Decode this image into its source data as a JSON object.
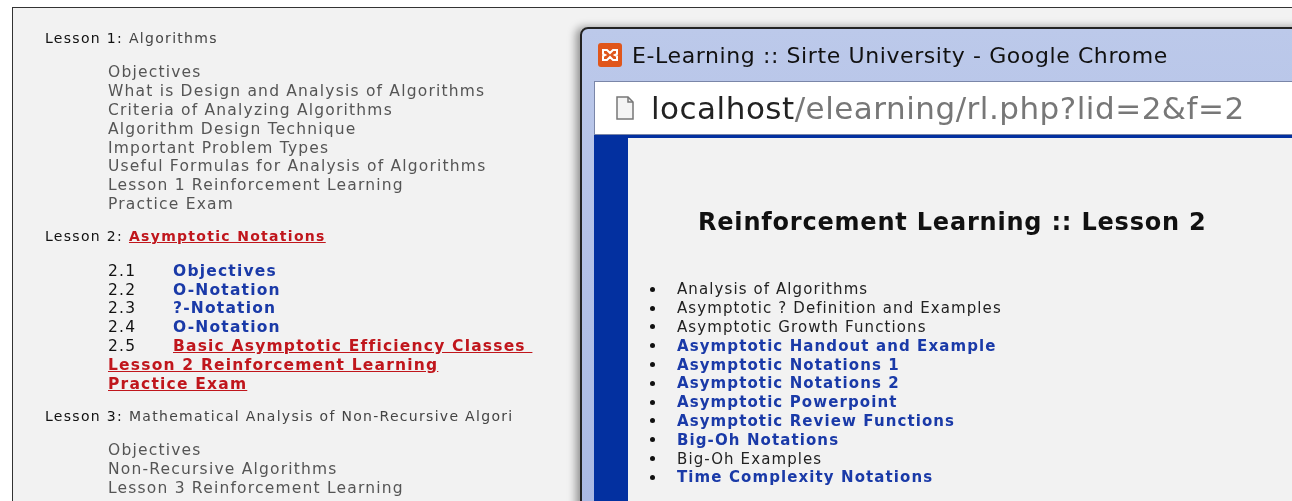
{
  "lessons": [
    {
      "label": "Lesson 1:",
      "title": "Algorithms",
      "kind": "plain",
      "items": [
        {
          "text": "Objectives",
          "kind": "plain"
        },
        {
          "text": "What is Design and Analysis of Algorithms",
          "kind": "plain"
        },
        {
          "text": "Criteria of Analyzing Algorithms",
          "kind": "plain"
        },
        {
          "text": "Algorithm Design Technique",
          "kind": "plain"
        },
        {
          "text": "Important Problem Types",
          "kind": "plain"
        },
        {
          "text": "Useful Formulas for Analysis of Algorithms",
          "kind": "plain"
        },
        {
          "text": "Lesson 1 Reinforcement Learning",
          "kind": "plain"
        },
        {
          "text": "Practice Exam",
          "kind": "plain"
        }
      ]
    },
    {
      "label": "Lesson 2:",
      "title": "Asymptotic Notations",
      "kind": "visited",
      "items": [
        {
          "number": "2.1",
          "text": "Objectives",
          "kind": "link"
        },
        {
          "number": "2.2",
          "text": "O-Notation",
          "kind": "link"
        },
        {
          "number": "2.3",
          "text": "?-Notation",
          "kind": "link"
        },
        {
          "number": "2.4",
          "text": "O-Notation",
          "kind": "link"
        },
        {
          "number": "2.5",
          "text": "Basic Asymptotic Efficiency Classes ",
          "kind": "visited"
        },
        {
          "text": "Lesson 2 Reinforcement Learning",
          "kind": "visited"
        },
        {
          "text": "Practice Exam",
          "kind": "visited"
        }
      ]
    },
    {
      "label": "Lesson 3:",
      "title": "Mathematical Analysis of Non-Recursive Algori",
      "kind": "plain",
      "items": [
        {
          "text": "Objectives",
          "kind": "plain"
        },
        {
          "text": "Non-Recursive Algorithms",
          "kind": "plain"
        },
        {
          "text": "Lesson 3 Reinforcement Learning",
          "kind": "plain"
        }
      ]
    }
  ],
  "popup": {
    "title": "E-Learning :: Sirte University - Google Chrome",
    "url_host": "localhost",
    "url_path": "/elearning/rl.php?lid=2&f=2",
    "heading": "Reinforcement Learning :: Lesson 2",
    "links": [
      {
        "text": "Analysis of Algorithms",
        "kind": "plain"
      },
      {
        "text": "Asymptotic ? Definition and Examples",
        "kind": "plain"
      },
      {
        "text": "Asymptotic Growth Functions",
        "kind": "plain"
      },
      {
        "text": "Asymptotic Handout and Example",
        "kind": "link"
      },
      {
        "text": "Asymptotic Notations 1",
        "kind": "link"
      },
      {
        "text": "Asymptotic Notations 2",
        "kind": "link"
      },
      {
        "text": "Asymptotic Powerpoint",
        "kind": "link"
      },
      {
        "text": "Asymptotic Review Functions",
        "kind": "link"
      },
      {
        "text": "Big-Oh Notations",
        "kind": "link"
      },
      {
        "text": "Big-Oh Examples",
        "kind": "plain"
      },
      {
        "text": "Time Complexity Notations",
        "kind": "link"
      }
    ]
  }
}
